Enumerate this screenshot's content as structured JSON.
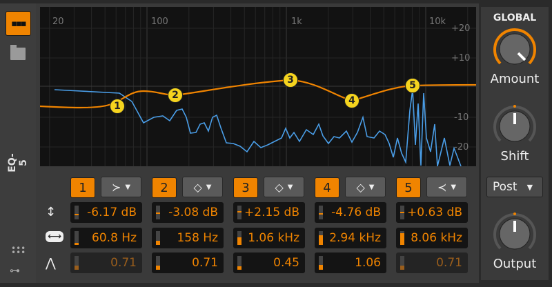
{
  "device": {
    "name": "EQ-5",
    "icons": [
      "eq-display-icon",
      "folder-icon",
      "grid-dots-icon",
      "key-icon"
    ]
  },
  "graph": {
    "freq_labels": [
      "20",
      "100",
      "1k",
      "10k"
    ],
    "db_labels": [
      "+20",
      "+10",
      "-10",
      "-20"
    ]
  },
  "bands": [
    {
      "num": "1",
      "type": "low-cut",
      "gain": "-6.17 dB",
      "freq": "60.8 Hz",
      "q": "0.71",
      "q_enabled": false,
      "gain_level": 0.35,
      "freq_level": 0.15,
      "q_level": 0.3
    },
    {
      "num": "2",
      "type": "bell",
      "gain": "-3.08 dB",
      "freq": "158 Hz",
      "q": "0.71",
      "q_enabled": true,
      "gain_level": 0.42,
      "freq_level": 0.3,
      "q_level": 0.3
    },
    {
      "num": "3",
      "type": "bell",
      "gain": "+2.15 dB",
      "freq": "1.06 kHz",
      "q": "0.45",
      "q_enabled": true,
      "gain_level": 0.55,
      "freq_level": 0.55,
      "q_level": 0.25
    },
    {
      "num": "4",
      "type": "bell",
      "gain": "-4.76 dB",
      "freq": "2.94 kHz",
      "q": "1.06",
      "q_enabled": true,
      "gain_level": 0.38,
      "freq_level": 0.7,
      "q_level": 0.35
    },
    {
      "num": "5",
      "type": "high-cut",
      "gain": "+0.63 dB",
      "freq": "8.06 kHz",
      "q": "0.71",
      "q_enabled": false,
      "gain_level": 0.5,
      "freq_level": 0.85,
      "q_level": 0.3
    }
  ],
  "global": {
    "title": "GLOBAL",
    "amount_label": "Amount",
    "shift_label": "Shift",
    "mode": "Post",
    "output_label": "Output"
  },
  "colors": {
    "accent": "#f08400",
    "spectrum": "#4a9ee8",
    "handle": "#f5d41e"
  }
}
